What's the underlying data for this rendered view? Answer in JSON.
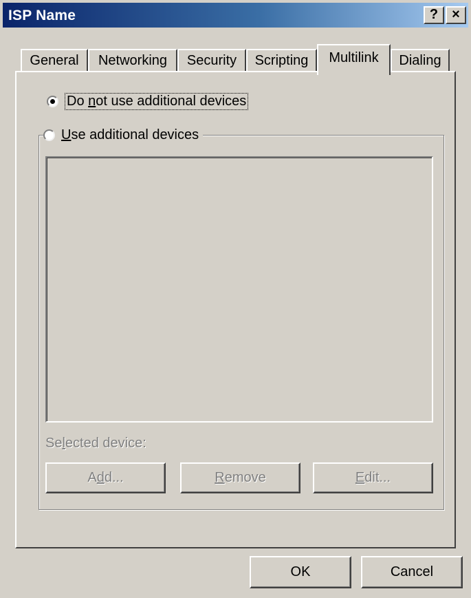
{
  "window": {
    "title": "ISP Name",
    "help_glyph": "?",
    "close_glyph": "×"
  },
  "tabs": [
    {
      "label": "General",
      "active": false
    },
    {
      "label": "Networking",
      "active": false
    },
    {
      "label": "Security",
      "active": false
    },
    {
      "label": "Scripting",
      "active": false
    },
    {
      "label": "Multilink",
      "active": true
    },
    {
      "label": "Dialing",
      "active": false
    }
  ],
  "multilink": {
    "option_no_additional": {
      "label_pre": "Do ",
      "label_key": "n",
      "label_post": "ot use additional devices",
      "checked": true
    },
    "option_use_additional": {
      "label_pre": "",
      "label_key": "U",
      "label_post": "se additional devices",
      "checked": false
    },
    "selected_device_label": {
      "pre": "Se",
      "key": "l",
      "post": "ected device:"
    },
    "add_button": {
      "pre": "A",
      "key": "d",
      "post": "d..."
    },
    "remove_button": {
      "pre": "",
      "key": "R",
      "post": "emove"
    },
    "edit_button": {
      "pre": "",
      "key": "E",
      "post": "dit..."
    }
  },
  "footer": {
    "ok_label": "OK",
    "cancel_label": "Cancel"
  }
}
